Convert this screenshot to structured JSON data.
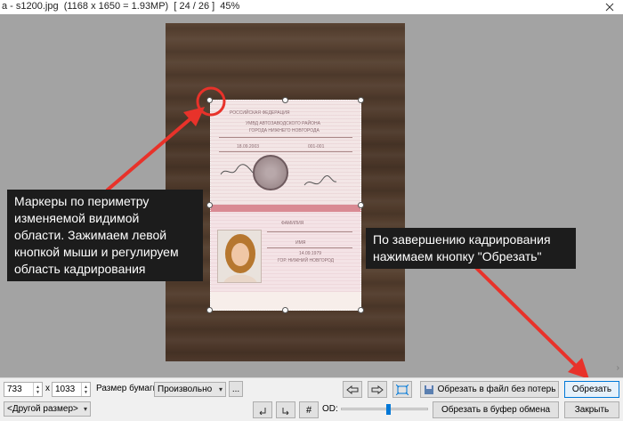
{
  "window": {
    "title": "a - s1200.jpg  (1168 x 1650 = 1.93MP)  [ 24 / 26 ]  45%"
  },
  "passport": {
    "header": "РОССИЙСКАЯ ФЕДЕРАЦИЯ",
    "issued_by_1": "УМВД АВТОЗАВОДСКОГО РАЙОНА",
    "issued_by_2": "ГОРОДА НИЖНЕГО НОВГОРОДА",
    "issue_date": "18.09.2003",
    "dept_code": "001-001",
    "surname_label": "ФАМИЛИЯ",
    "name_label": "ИМЯ",
    "birth_date": "14.09.1979",
    "birth_place": "ГОР. НИЖНИЙ НОВГОРОД"
  },
  "callouts": {
    "markers": [
      "Маркеры по периметру",
      "изменяемой видимой",
      "области. Зажимаем левой",
      "кнопкой мыши и регулируем",
      "область кадрирования"
    ],
    "finish": [
      "По завершению кадрирования",
      "нажимаем кнопку \"Обрезать\""
    ]
  },
  "toolbar": {
    "width_value": "733",
    "times": "x",
    "height_value": "1033",
    "paper_size_label": "Размер бумаги:",
    "paper_size_value": "Произвольно",
    "more_button": "...",
    "other_size_value": "<Другой размер>",
    "crop_to_file_button": "Обрезать в файл без потерь",
    "crop_button": "Обрезать",
    "crop_to_clipboard_button": "Обрезать в буфер обмена",
    "close_button": "Закрыть",
    "od_label": "OD:",
    "od_value": 0.55
  },
  "colors": {
    "canvas": "#a3a3a3",
    "arrow": "#e8322a",
    "accent": "#0078d7"
  }
}
